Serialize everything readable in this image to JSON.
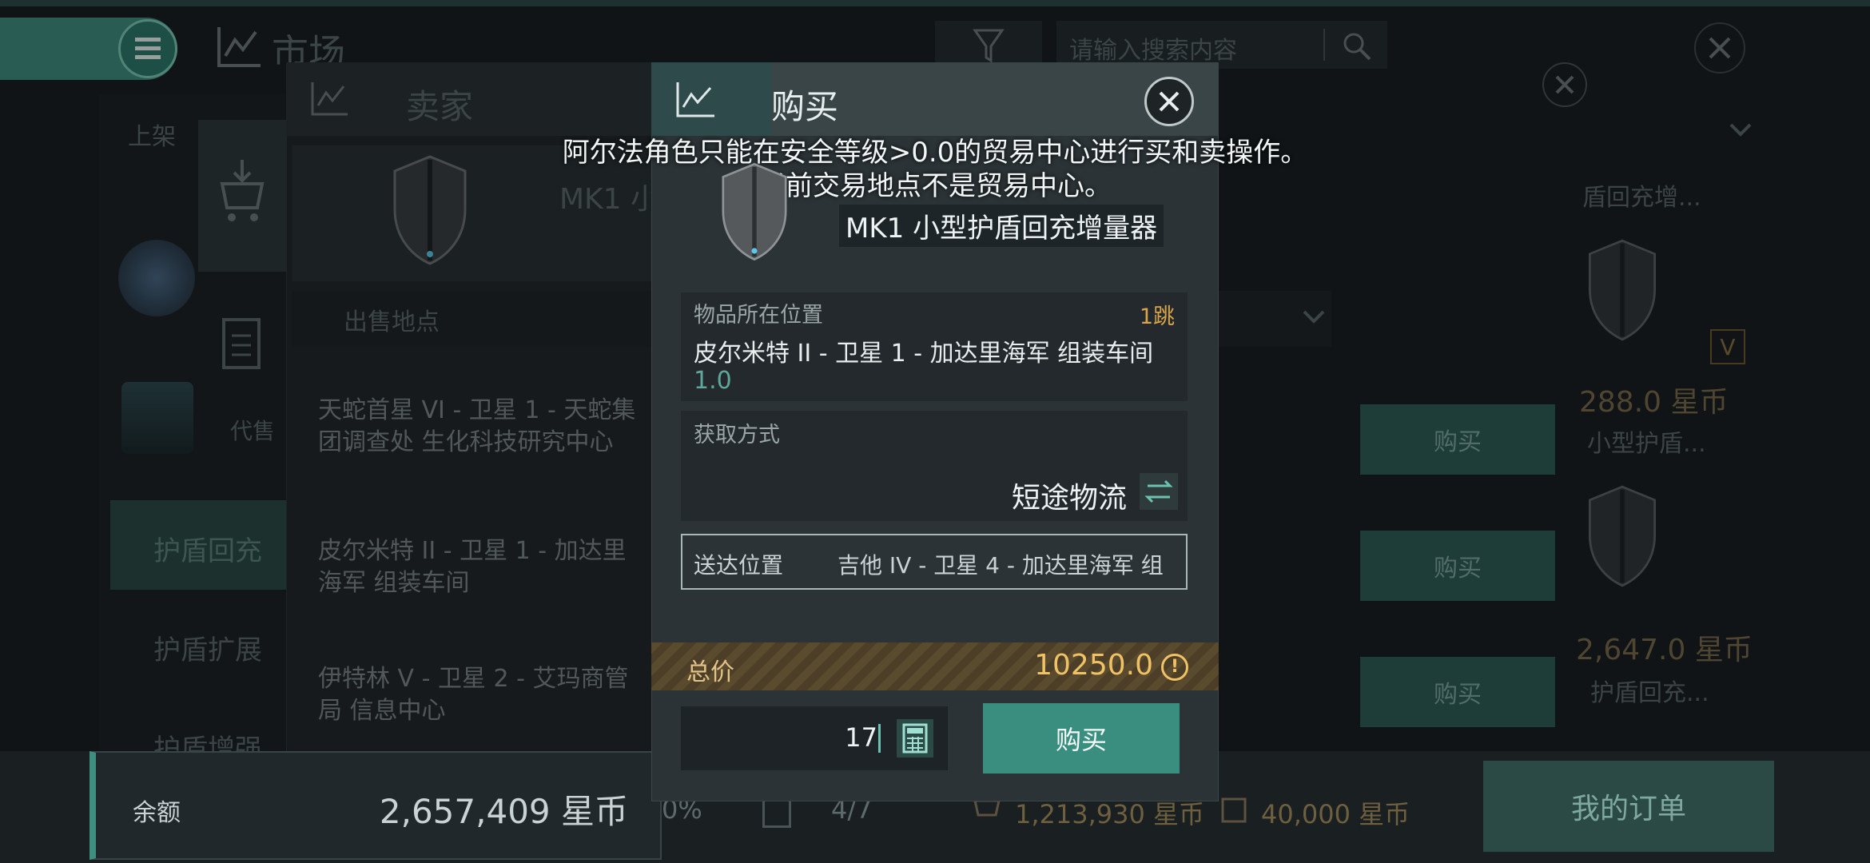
{
  "top": {
    "title": "市场",
    "search_placeholder": "请输入搜索内容"
  },
  "left_panel": {
    "tab1": "上架",
    "side_label": "代售",
    "categories": [
      "护盾回充",
      "护盾扩展",
      "护盾增强"
    ]
  },
  "seller_panel": {
    "title": "卖家",
    "item_short": "MK1 小",
    "location_header": "出售地点",
    "locations": [
      "天蛇首星 VI - 卫星 1 - 天蛇集团调查处 生化科技研究中心",
      "皮尔米特 II - 卫星 1 - 加达里海军 组装车间",
      "伊特林 V - 卫星 2 - 艾玛商管局 信息中心"
    ],
    "buy_label": "购买"
  },
  "right_panel": {
    "items": [
      {
        "name": "盾回充增...",
        "price": "288.0 星币",
        "badge": "V"
      },
      {
        "name": "小型护盾...",
        "price": "2,647.0 星币"
      },
      {
        "name": "护盾回充...",
        "price": ""
      }
    ]
  },
  "buy_modal": {
    "title": "购买",
    "warning": "阿尔法角色只能在安全等级>0.0的贸易中心进行买和卖操作。当前交易地点不是贸易中心。",
    "item_name": "MK1 小型护盾回充增量器",
    "location_label": "物品所在位置",
    "jumps": "1跳",
    "location_value": "皮尔米特 II - 卫星 1 - 加达里海军 组装车间",
    "location_security": "1.0",
    "acquire_label": "获取方式",
    "acquire_value": "短途物流",
    "delivery_label": "送达位置",
    "delivery_value": "吉他 IV - 卫星 4 - 加达里海军 组",
    "total_label": "总价",
    "total_value": "10250.0",
    "quantity": "17",
    "buy_button": "购买"
  },
  "bottom": {
    "balance_label": "余额",
    "balance_value": "2,657,409 星币",
    "percent": "0%",
    "slots": "4/7",
    "escrow": "1,213,930 星币",
    "fees": "40,000 星币",
    "my_orders": "我的订单"
  }
}
